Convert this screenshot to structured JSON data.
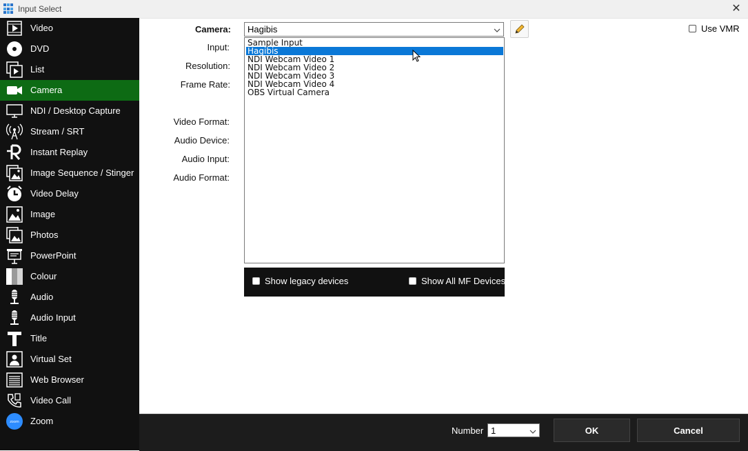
{
  "window": {
    "title": "Input Select"
  },
  "sidebar": {
    "items": [
      {
        "label": "Video",
        "icon": "video-file-icon"
      },
      {
        "label": "DVD",
        "icon": "disc-icon"
      },
      {
        "label": "List",
        "icon": "list-icon"
      },
      {
        "label": "Camera",
        "icon": "camera-icon",
        "active": true
      },
      {
        "label": "NDI / Desktop Capture",
        "icon": "monitor-icon"
      },
      {
        "label": "Stream / SRT",
        "icon": "broadcast-icon"
      },
      {
        "label": "Instant Replay",
        "icon": "replay-icon"
      },
      {
        "label": "Image Sequence / Stinger",
        "icon": "image-sequence-icon"
      },
      {
        "label": "Video Delay",
        "icon": "clock-icon"
      },
      {
        "label": "Image",
        "icon": "image-icon"
      },
      {
        "label": "Photos",
        "icon": "photos-icon"
      },
      {
        "label": "PowerPoint",
        "icon": "projector-icon"
      },
      {
        "label": "Colour",
        "icon": "colour-icon"
      },
      {
        "label": "Audio",
        "icon": "microphone-icon"
      },
      {
        "label": "Audio Input",
        "icon": "audio-input-icon"
      },
      {
        "label": "Title",
        "icon": "title-icon"
      },
      {
        "label": "Virtual Set",
        "icon": "virtual-set-icon"
      },
      {
        "label": "Web Browser",
        "icon": "web-browser-icon"
      },
      {
        "label": "Video Call",
        "icon": "video-call-icon"
      },
      {
        "label": "Zoom",
        "icon": "zoom-icon"
      }
    ],
    "active_color": "#0d6b14"
  },
  "form": {
    "camera_label": "Camera:",
    "input_label": "Input:",
    "resolution_label": "Resolution:",
    "frame_rate_label": "Frame Rate:",
    "video_format_label": "Video Format:",
    "audio_device_label": "Audio Device:",
    "audio_input_label": "Audio Input:",
    "audio_format_label": "Audio Format:",
    "camera_value": "Hagibis",
    "camera_options": [
      "Sample Input",
      "Hagibis",
      "NDI Webcam Video 1",
      "NDI Webcam Video 2",
      "NDI Webcam Video 3",
      "NDI Webcam Video 4",
      "OBS Virtual Camera"
    ],
    "selected_index": 1,
    "use_vmr_label": "Use VMR",
    "show_legacy_label": "Show legacy devices",
    "show_all_mf_label": "Show All MF Devices"
  },
  "footer": {
    "number_label": "Number",
    "number_value": "1",
    "ok_label": "OK",
    "cancel_label": "Cancel"
  },
  "colors": {
    "selection": "#0a78d7",
    "sidebar_bg": "#111111",
    "footer_bg": "#1c1c1c"
  }
}
